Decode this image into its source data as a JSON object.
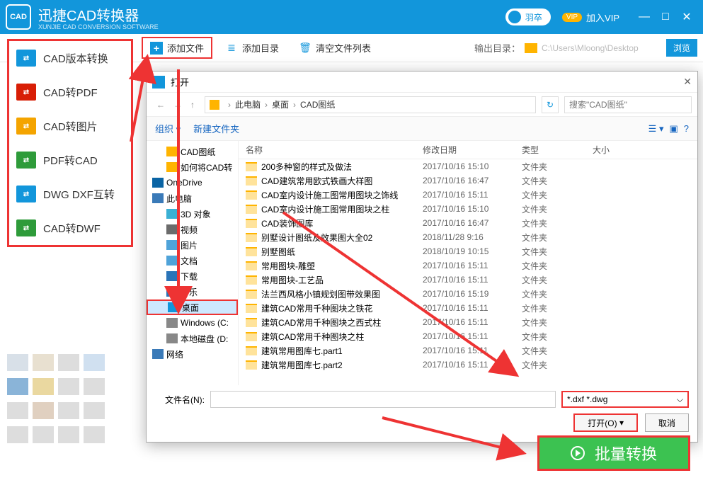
{
  "titlebar": {
    "logo_text": "CAD",
    "app_title": "迅捷CAD转换器",
    "app_sub": "XUNJIE CAD CONVERSION SOFTWARE",
    "user_name": "羽卒",
    "vip_badge": "VIP",
    "vip_label": "加入VIP"
  },
  "toolbar": {
    "add_file": "添加文件",
    "add_dir": "添加目录",
    "clear": "清空文件列表",
    "out_label": "输出目录：",
    "out_path": "C:\\Users\\Mloong\\Desktop",
    "browse": "浏览"
  },
  "sidebar": {
    "items": [
      {
        "label": "CAD版本转换",
        "color": "#1296db"
      },
      {
        "label": "CAD转PDF",
        "color": "#d81e06"
      },
      {
        "label": "CAD转图片",
        "color": "#f4a400"
      },
      {
        "label": "PDF转CAD",
        "color": "#2e9b3a"
      },
      {
        "label": "DWG DXF互转",
        "color": "#1296db"
      },
      {
        "label": "CAD转DWF",
        "color": "#2e9b3a"
      }
    ]
  },
  "dialog": {
    "title": "打开",
    "crumb": [
      "此电脑",
      "桌面",
      "CAD图纸"
    ],
    "search_placeholder": "搜索\"CAD图纸\"",
    "cmd_organize": "组织",
    "cmd_newfolder": "新建文件夹",
    "tree": [
      {
        "label": "CAD图纸",
        "lv": 1,
        "ico": "#ffb400"
      },
      {
        "label": "如何将CAD转",
        "lv": 1,
        "ico": "#ffb400"
      },
      {
        "label": "OneDrive",
        "lv": 0,
        "ico": "#0a64a4"
      },
      {
        "label": "此电脑",
        "lv": 0,
        "ico": "#3a7ab8"
      },
      {
        "label": "3D 对象",
        "lv": 1,
        "ico": "#3ab0d4"
      },
      {
        "label": "视频",
        "lv": 1,
        "ico": "#6b6b6b"
      },
      {
        "label": "图片",
        "lv": 1,
        "ico": "#4fa3d9"
      },
      {
        "label": "文档",
        "lv": 1,
        "ico": "#4fa3d9"
      },
      {
        "label": "下载",
        "lv": 1,
        "ico": "#2a74b8"
      },
      {
        "label": "音乐",
        "lv": 1,
        "ico": "#2a74b8"
      },
      {
        "label": "桌面",
        "lv": 1,
        "ico": "#1296db",
        "sel": true
      },
      {
        "label": "Windows (C:",
        "lv": 1,
        "ico": "#888"
      },
      {
        "label": "本地磁盘 (D:",
        "lv": 1,
        "ico": "#888"
      },
      {
        "label": "网络",
        "lv": 0,
        "ico": "#3a7ab8"
      }
    ],
    "columns": {
      "name": "名称",
      "date": "修改日期",
      "type": "类型",
      "size": "大小"
    },
    "rows": [
      {
        "name": "200多种窗的样式及做法",
        "date": "2017/10/16 15:10",
        "type": "文件夹"
      },
      {
        "name": "CAD建筑常用欧式铁画大样图",
        "date": "2017/10/16 16:47",
        "type": "文件夹"
      },
      {
        "name": "CAD室内设计施工图常用图块之饰线",
        "date": "2017/10/16 15:11",
        "type": "文件夹"
      },
      {
        "name": "CAD室内设计施工图常用图块之柱",
        "date": "2017/10/16 15:10",
        "type": "文件夹"
      },
      {
        "name": "CAD装饰图库",
        "date": "2017/10/16 16:47",
        "type": "文件夹"
      },
      {
        "name": "别墅设计图纸及效果图大全02",
        "date": "2018/11/28 9:16",
        "type": "文件夹"
      },
      {
        "name": "别墅图纸",
        "date": "2018/10/19 10:15",
        "type": "文件夹"
      },
      {
        "name": "常用图块-雕塑",
        "date": "2017/10/16 15:11",
        "type": "文件夹"
      },
      {
        "name": "常用图块-工艺品",
        "date": "2017/10/16 15:11",
        "type": "文件夹"
      },
      {
        "name": "法兰西风格小镇规划图带效果图",
        "date": "2017/10/16 15:19",
        "type": "文件夹"
      },
      {
        "name": "建筑CAD常用千种图块之铁花",
        "date": "2017/10/16 15:11",
        "type": "文件夹"
      },
      {
        "name": "建筑CAD常用千种图块之西式柱",
        "date": "2017/10/16 15:11",
        "type": "文件夹"
      },
      {
        "name": "建筑CAD常用千种图块之柱",
        "date": "2017/10/16 15:11",
        "type": "文件夹"
      },
      {
        "name": "建筑常用图库七.part1",
        "date": "2017/10/16 15:11",
        "type": "文件夹"
      },
      {
        "name": "建筑常用图库七.part2",
        "date": "2017/10/16 15:11",
        "type": "文件夹"
      }
    ],
    "filename_label": "文件名(N):",
    "filetype": "*.dxf *.dwg",
    "open_btn": "打开(O)",
    "cancel_btn": "取消"
  },
  "convert_btn": "批量转换"
}
